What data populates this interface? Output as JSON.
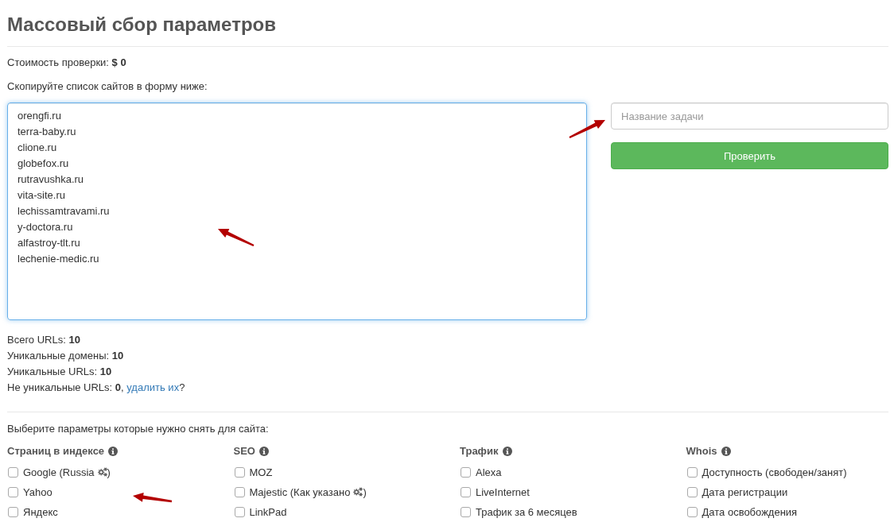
{
  "page": {
    "title": "Массовый сбор параметров"
  },
  "cost": "Стоимость проверки: **$ 0**",
  "instruction": "Скопируйте список сайтов в форму ниже:",
  "sites_field": {
    "lines": [
      "orengfi.ru",
      "terra-baby.ru",
      "clione.ru",
      "globefox.ru",
      "rutravushka.ru",
      "vita-site.ru",
      "lechissamtravami.ru",
      "y-doctora.ru",
      "alfastroy-tlt.ru",
      "lechenie-medic.ru"
    ]
  },
  "task_name_field": {
    "placeholder": "Название задачи"
  },
  "check_button": {
    "label": "Проверить"
  },
  "stats": [
    {
      "text": "Всего URLs: **10**"
    },
    {
      "text": "Уникальные домены: **10**"
    },
    {
      "text": "Уникальные URLs: **10**"
    },
    {
      "text": "Не уникальные URLs: **0**, ",
      "link": "удалить их",
      "after": "?"
    }
  ],
  "params_prompt": "Выберите параметры которые нужно снять для сайта:",
  "param_groups": [
    {
      "title": "Страниц в индексе",
      "options": [
        {
          "kind": "settings",
          "label": "Google (Russia",
          "after_icon": ")",
          "checked": false
        },
        {
          "kind": "plain",
          "label": "Yahoo",
          "checked": false
        },
        {
          "kind": "plain",
          "label": "Яндекс",
          "checked": false
        }
      ]
    },
    {
      "title": "SEO",
      "options": [
        {
          "kind": "plain",
          "label": "MOZ",
          "checked": false
        },
        {
          "kind": "settings",
          "label": "Majestic (Как указано",
          "after_icon": ")",
          "checked": false
        },
        {
          "kind": "plain",
          "label": "LinkPad",
          "checked": false
        }
      ]
    },
    {
      "title": "Трафик",
      "options": [
        {
          "kind": "plain",
          "label": "Alexa",
          "checked": false
        },
        {
          "kind": "plain",
          "label": "LiveInternet",
          "checked": false
        },
        {
          "kind": "plain",
          "label": "Трафик за 6 месяцев",
          "checked": false
        }
      ]
    },
    {
      "title": "Whois",
      "options": [
        {
          "kind": "plain",
          "label": "Доступность (свободен/занят)",
          "checked": false
        },
        {
          "kind": "plain",
          "label": "Дата регистрации",
          "checked": false
        },
        {
          "kind": "plain",
          "label": "Дата освобождения",
          "checked": false
        }
      ]
    }
  ]
}
